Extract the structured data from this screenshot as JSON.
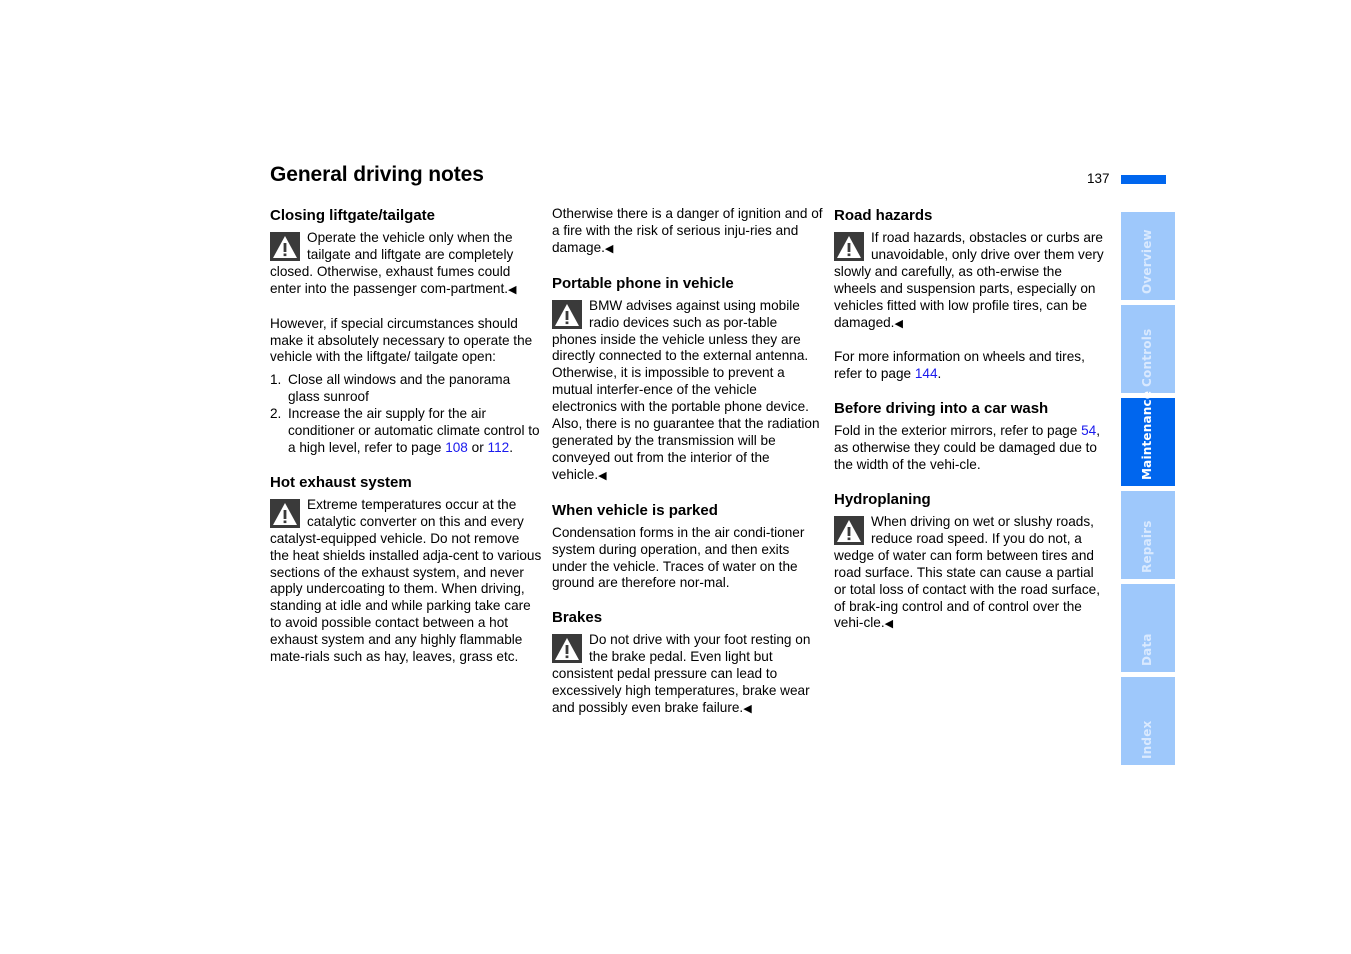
{
  "header": {
    "title": "General driving notes",
    "page_number": "137"
  },
  "end_mark": "◀",
  "tabs": [
    {
      "label": "Overview",
      "active": false
    },
    {
      "label": "Controls",
      "active": false
    },
    {
      "label": "Maintenance",
      "active": true
    },
    {
      "label": "Repairs",
      "active": false
    },
    {
      "label": "Data",
      "active": false
    },
    {
      "label": "Index",
      "active": false
    }
  ],
  "colors": {
    "accent": "#0066ee",
    "tab_inactive": "#9ec8fb",
    "link": "#1a1aee"
  },
  "col1": {
    "liftgate": {
      "heading": "Closing liftgate/tailgate",
      "warning": "Operate the vehicle only when the tailgate and liftgate are completely closed. Otherwise, exhaust fumes could enter into the passenger com-partment.",
      "para": "However, if special circumstances should make it absolutely necessary to operate the vehicle with the liftgate/ tailgate open:",
      "list": [
        {
          "num": "1.",
          "text": "Close all windows and the panorama glass sunroof"
        },
        {
          "num": "2.",
          "text_before": "Increase the air supply for the air conditioner or automatic climate control to a high level, refer to page ",
          "link1": "108",
          "mid": " or ",
          "link2": "112",
          "after": "."
        }
      ]
    },
    "exhaust": {
      "heading": "Hot exhaust system",
      "warning": "Extreme temperatures occur at the catalytic converter on this and every catalyst-equipped vehicle. Do not remove the heat shields installed adja-cent to various sections of the exhaust system, and never apply undercoating to them. When driving, standing at idle and while parking take care to avoid possible contact between a hot exhaust system and any highly flammable mate-rials such as hay, leaves, grass etc."
    }
  },
  "col2": {
    "continuation": "Otherwise there is a danger of ignition and of a fire with the risk of serious inju-ries and damage.",
    "phone": {
      "heading": "Portable phone in vehicle",
      "warning": "BMW advises against using mobile radio devices such as por-table phones inside the vehicle unless they are directly connected to the external antenna. Otherwise, it is impossible to prevent a mutual interfer-ence of the vehicle electronics with the portable phone device. Also, there is no guarantee that the radiation generated by the transmission will be conveyed out from the interior of the vehicle."
    },
    "parked": {
      "heading": "When vehicle is parked",
      "text": "Condensation forms in the air condi-tioner system during operation, and then exits under the vehicle. Traces of water on the ground are therefore nor-mal."
    },
    "brakes": {
      "heading": "Brakes",
      "warning": "Do not drive with your foot resting on the brake pedal. Even light but consistent pedal pressure can lead to excessively high temperatures, brake wear and possibly even brake failure."
    }
  },
  "col3": {
    "road": {
      "heading": "Road hazards",
      "warning": "If road hazards, obstacles or curbs are unavoidable, only drive over them very slowly and carefully, as oth-erwise the wheels and suspension parts, especially on vehicles fitted with low profile tires, can be damaged.",
      "more_before": "For more information on wheels and tires, refer to page ",
      "more_link": "144",
      "more_after": "."
    },
    "carwash": {
      "heading": "Before driving into a car wash",
      "before": "Fold in the exterior mirrors, refer to page ",
      "link": "54",
      "after": ", as otherwise they could be damaged due to the width of the vehi-cle."
    },
    "hydro": {
      "heading": "Hydroplaning",
      "warning": "When driving on wet or slushy roads, reduce road speed. If you do not, a wedge of water can form between tires and road surface. This state can cause a partial or total loss of contact with the road surface, of brak-ing control and of control over the vehi-cle."
    }
  }
}
